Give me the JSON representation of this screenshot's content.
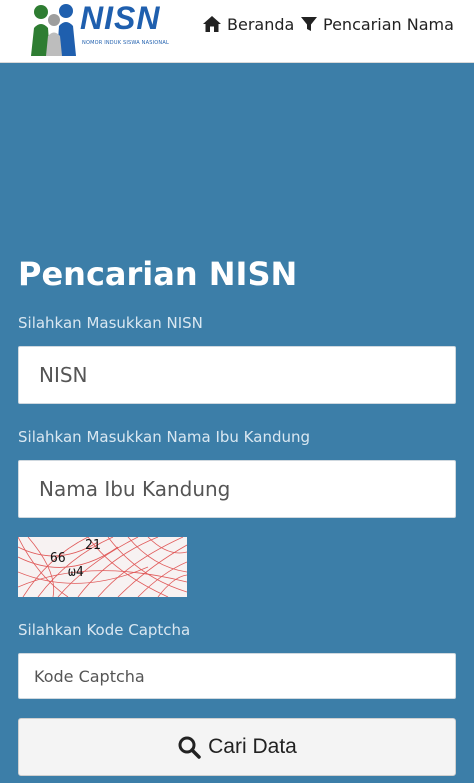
{
  "header": {
    "logo_text": "NISN",
    "logo_subtitle": "NOMOR INDUK SISWA NASIONAL",
    "nav": [
      {
        "label": "Beranda",
        "icon": "home-icon"
      },
      {
        "label": "Pencarian Nama",
        "icon": "filter-icon"
      }
    ]
  },
  "main": {
    "title": "Pencarian NISN",
    "nisn_label": "Silahkan Masukkan NISN",
    "nisn_placeholder": "NISN",
    "ibu_label": "Silahkan Masukkan Nama Ibu Kandung",
    "ibu_placeholder": "Nama Ibu Kandung",
    "captcha_chars": [
      "66",
      "21",
      "ω4"
    ],
    "captcha_label": "Silahkan Kode Captcha",
    "captcha_placeholder": "Kode Captcha",
    "submit_label": "Cari Data",
    "submit_icon": "search-icon"
  },
  "colors": {
    "background": "#3c7ea8",
    "brand_blue": "#1f5fae",
    "captcha_lines": "#e05a5a"
  }
}
